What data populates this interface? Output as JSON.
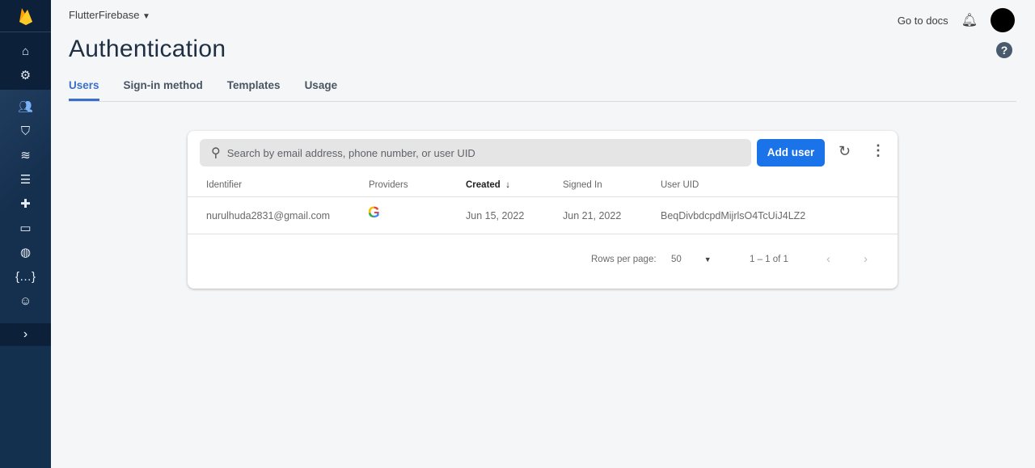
{
  "header": {
    "project": "FlutterFirebase",
    "go_to_docs": "Go to docs",
    "title": "Authentication"
  },
  "tabs": [
    "Users",
    "Sign-in method",
    "Templates",
    "Usage"
  ],
  "search": {
    "placeholder": "Search by email address, phone number, or user UID"
  },
  "add_user": "Add user",
  "columns": [
    "Identifier",
    "Providers",
    "Created",
    "Signed In",
    "User UID"
  ],
  "rows": [
    {
      "identifier": "nurulhuda2831@gmail.com",
      "provider": "google",
      "created": "Jun 15, 2022",
      "signed_in": "Jun 21, 2022",
      "uid": "BeqDivbdcpdMijrlsO4TcUiJ4LZ2"
    }
  ],
  "pagination": {
    "rows_per_page_label": "Rows per page:",
    "rows_per_page": "50",
    "range": "1 – 1 of 1"
  },
  "colors": {
    "accent": "#1a73e8",
    "sidebar": "#14304f"
  }
}
